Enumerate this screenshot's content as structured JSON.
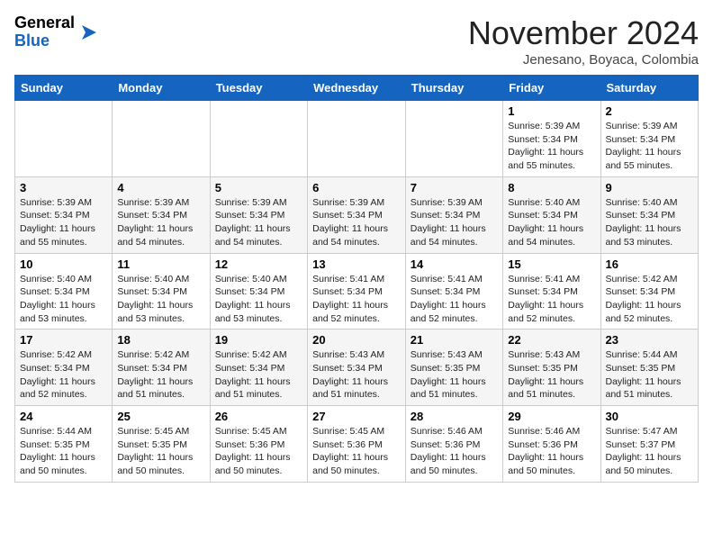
{
  "header": {
    "logo": {
      "line1": "General",
      "line2": "Blue"
    },
    "title": "November 2024",
    "location": "Jenesano, Boyaca, Colombia"
  },
  "weekdays": [
    "Sunday",
    "Monday",
    "Tuesday",
    "Wednesday",
    "Thursday",
    "Friday",
    "Saturday"
  ],
  "weeks": [
    [
      {
        "day": "",
        "info": ""
      },
      {
        "day": "",
        "info": ""
      },
      {
        "day": "",
        "info": ""
      },
      {
        "day": "",
        "info": ""
      },
      {
        "day": "",
        "info": ""
      },
      {
        "day": "1",
        "info": "Sunrise: 5:39 AM\nSunset: 5:34 PM\nDaylight: 11 hours and 55 minutes."
      },
      {
        "day": "2",
        "info": "Sunrise: 5:39 AM\nSunset: 5:34 PM\nDaylight: 11 hours and 55 minutes."
      }
    ],
    [
      {
        "day": "3",
        "info": "Sunrise: 5:39 AM\nSunset: 5:34 PM\nDaylight: 11 hours and 55 minutes."
      },
      {
        "day": "4",
        "info": "Sunrise: 5:39 AM\nSunset: 5:34 PM\nDaylight: 11 hours and 54 minutes."
      },
      {
        "day": "5",
        "info": "Sunrise: 5:39 AM\nSunset: 5:34 PM\nDaylight: 11 hours and 54 minutes."
      },
      {
        "day": "6",
        "info": "Sunrise: 5:39 AM\nSunset: 5:34 PM\nDaylight: 11 hours and 54 minutes."
      },
      {
        "day": "7",
        "info": "Sunrise: 5:39 AM\nSunset: 5:34 PM\nDaylight: 11 hours and 54 minutes."
      },
      {
        "day": "8",
        "info": "Sunrise: 5:40 AM\nSunset: 5:34 PM\nDaylight: 11 hours and 54 minutes."
      },
      {
        "day": "9",
        "info": "Sunrise: 5:40 AM\nSunset: 5:34 PM\nDaylight: 11 hours and 53 minutes."
      }
    ],
    [
      {
        "day": "10",
        "info": "Sunrise: 5:40 AM\nSunset: 5:34 PM\nDaylight: 11 hours and 53 minutes."
      },
      {
        "day": "11",
        "info": "Sunrise: 5:40 AM\nSunset: 5:34 PM\nDaylight: 11 hours and 53 minutes."
      },
      {
        "day": "12",
        "info": "Sunrise: 5:40 AM\nSunset: 5:34 PM\nDaylight: 11 hours and 53 minutes."
      },
      {
        "day": "13",
        "info": "Sunrise: 5:41 AM\nSunset: 5:34 PM\nDaylight: 11 hours and 52 minutes."
      },
      {
        "day": "14",
        "info": "Sunrise: 5:41 AM\nSunset: 5:34 PM\nDaylight: 11 hours and 52 minutes."
      },
      {
        "day": "15",
        "info": "Sunrise: 5:41 AM\nSunset: 5:34 PM\nDaylight: 11 hours and 52 minutes."
      },
      {
        "day": "16",
        "info": "Sunrise: 5:42 AM\nSunset: 5:34 PM\nDaylight: 11 hours and 52 minutes."
      }
    ],
    [
      {
        "day": "17",
        "info": "Sunrise: 5:42 AM\nSunset: 5:34 PM\nDaylight: 11 hours and 52 minutes."
      },
      {
        "day": "18",
        "info": "Sunrise: 5:42 AM\nSunset: 5:34 PM\nDaylight: 11 hours and 51 minutes."
      },
      {
        "day": "19",
        "info": "Sunrise: 5:42 AM\nSunset: 5:34 PM\nDaylight: 11 hours and 51 minutes."
      },
      {
        "day": "20",
        "info": "Sunrise: 5:43 AM\nSunset: 5:34 PM\nDaylight: 11 hours and 51 minutes."
      },
      {
        "day": "21",
        "info": "Sunrise: 5:43 AM\nSunset: 5:35 PM\nDaylight: 11 hours and 51 minutes."
      },
      {
        "day": "22",
        "info": "Sunrise: 5:43 AM\nSunset: 5:35 PM\nDaylight: 11 hours and 51 minutes."
      },
      {
        "day": "23",
        "info": "Sunrise: 5:44 AM\nSunset: 5:35 PM\nDaylight: 11 hours and 51 minutes."
      }
    ],
    [
      {
        "day": "24",
        "info": "Sunrise: 5:44 AM\nSunset: 5:35 PM\nDaylight: 11 hours and 50 minutes."
      },
      {
        "day": "25",
        "info": "Sunrise: 5:45 AM\nSunset: 5:35 PM\nDaylight: 11 hours and 50 minutes."
      },
      {
        "day": "26",
        "info": "Sunrise: 5:45 AM\nSunset: 5:36 PM\nDaylight: 11 hours and 50 minutes."
      },
      {
        "day": "27",
        "info": "Sunrise: 5:45 AM\nSunset: 5:36 PM\nDaylight: 11 hours and 50 minutes."
      },
      {
        "day": "28",
        "info": "Sunrise: 5:46 AM\nSunset: 5:36 PM\nDaylight: 11 hours and 50 minutes."
      },
      {
        "day": "29",
        "info": "Sunrise: 5:46 AM\nSunset: 5:36 PM\nDaylight: 11 hours and 50 minutes."
      },
      {
        "day": "30",
        "info": "Sunrise: 5:47 AM\nSunset: 5:37 PM\nDaylight: 11 hours and 50 minutes."
      }
    ]
  ]
}
